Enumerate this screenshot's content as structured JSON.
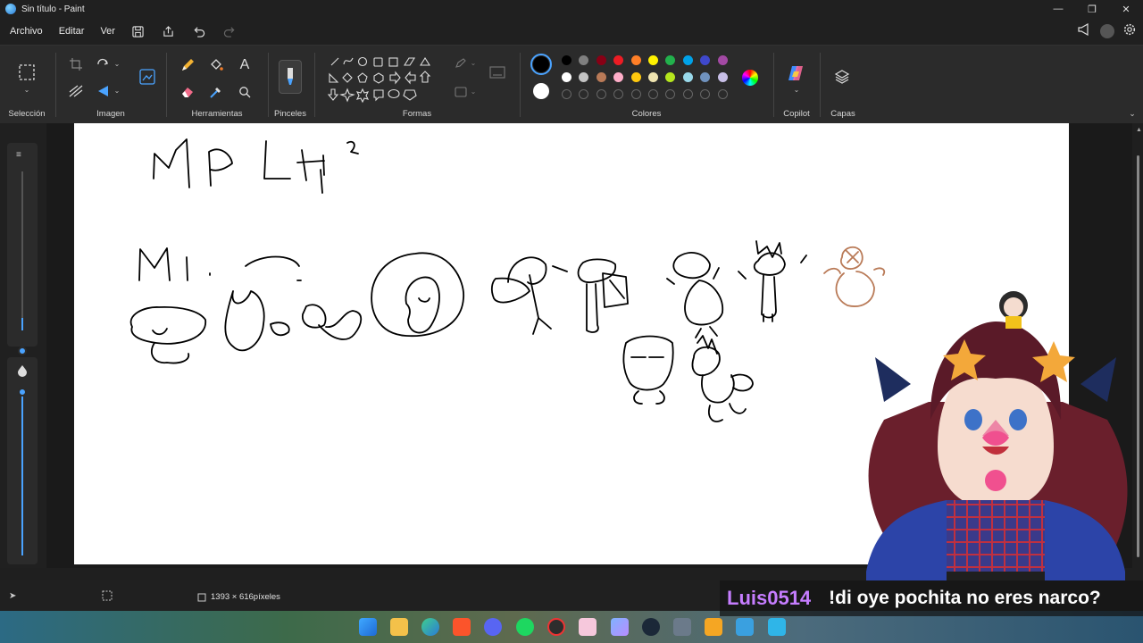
{
  "window": {
    "title": "Sin título - Paint"
  },
  "menu": {
    "items": [
      "Archivo",
      "Editar",
      "Ver"
    ]
  },
  "ribbon": {
    "groups": {
      "seleccion": "Selección",
      "imagen": "Imagen",
      "herramientas": "Herramientas",
      "pinceles": "Pinceles",
      "formas": "Formas",
      "colores": "Colores",
      "copilot": "Copilot",
      "capas": "Capas"
    },
    "palette_row1": [
      "#000000",
      "#7f7f7f",
      "#880015",
      "#ed1c24",
      "#ff7f27",
      "#fff200",
      "#22b14c",
      "#00a2e8",
      "#3f48cc",
      "#a349a4"
    ],
    "palette_row2": [
      "#ffffff",
      "#c3c3c3",
      "#b97a57",
      "#ffaec9",
      "#ffc90e",
      "#efe4b0",
      "#b5e61d",
      "#99d9ea",
      "#7092be",
      "#c8bfe7"
    ],
    "primary_color": "#000000",
    "secondary_color": "#ffffff"
  },
  "canvas": {
    "title_text": "MP LIT",
    "size_text": "1393 × 616píxeles"
  },
  "chat": {
    "user": "Luis0514",
    "message": "!di oye pochita no eres narco?"
  }
}
